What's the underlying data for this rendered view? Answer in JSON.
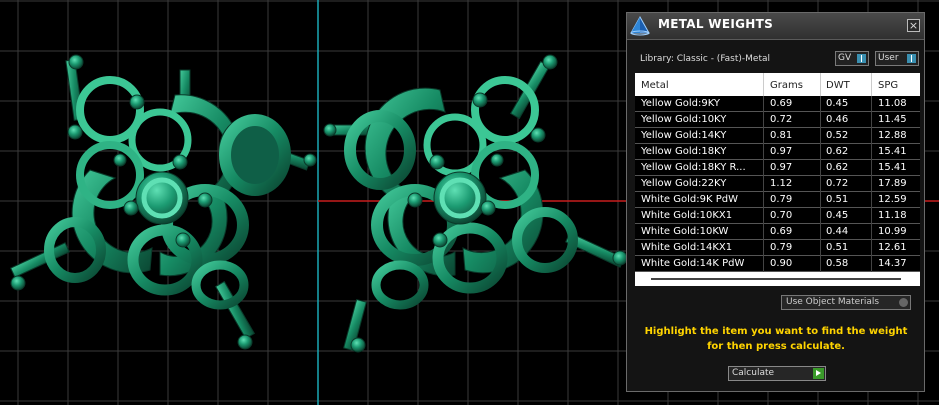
{
  "panel": {
    "title": "METAL WEIGHTS",
    "close_glyph": "×",
    "library_label": "Library: Classic - (Fast)-Metal",
    "toggles": {
      "gv": "GV",
      "user": "User"
    },
    "table": {
      "columns": [
        "Metal",
        "Grams",
        "DWT",
        "SPG"
      ],
      "rows": [
        [
          "Yellow Gold:9KY",
          "0.69",
          "0.45",
          "11.08"
        ],
        [
          "Yellow Gold:10KY",
          "0.72",
          "0.46",
          "11.45"
        ],
        [
          "Yellow Gold:14KY",
          "0.81",
          "0.52",
          "12.88"
        ],
        [
          "Yellow Gold:18KY",
          "0.97",
          "0.62",
          "15.41"
        ],
        [
          "Yellow Gold:18KY R...",
          "0.97",
          "0.62",
          "15.41"
        ],
        [
          "Yellow Gold:22KY",
          "1.12",
          "0.72",
          "17.89"
        ],
        [
          "White Gold:9K PdW",
          "0.79",
          "0.51",
          "12.59"
        ],
        [
          "White Gold:10KX1",
          "0.70",
          "0.45",
          "11.18"
        ],
        [
          "White Gold:10KW",
          "0.69",
          "0.44",
          "10.99"
        ],
        [
          "White Gold:14KX1",
          "0.79",
          "0.51",
          "12.61"
        ],
        [
          "White Gold:14K PdW",
          "0.90",
          "0.58",
          "14.37"
        ]
      ]
    },
    "use_object_materials": "Use Object Materials",
    "help_text": "Highlight the item you want to find the weight for then press calculate.",
    "calculate_label": "Calculate"
  },
  "icons": {
    "app": "pyramid-logo-icon",
    "close": "close-icon",
    "calculate": "play-arrow-icon"
  },
  "colors": {
    "viewport_bg": "#000000",
    "grid": "#3a3a3a",
    "axis_cyan": "#1aa7b5",
    "axis_red": "#c81e1e",
    "model_green": "#1a8a68",
    "help_text": "#ffd400"
  }
}
